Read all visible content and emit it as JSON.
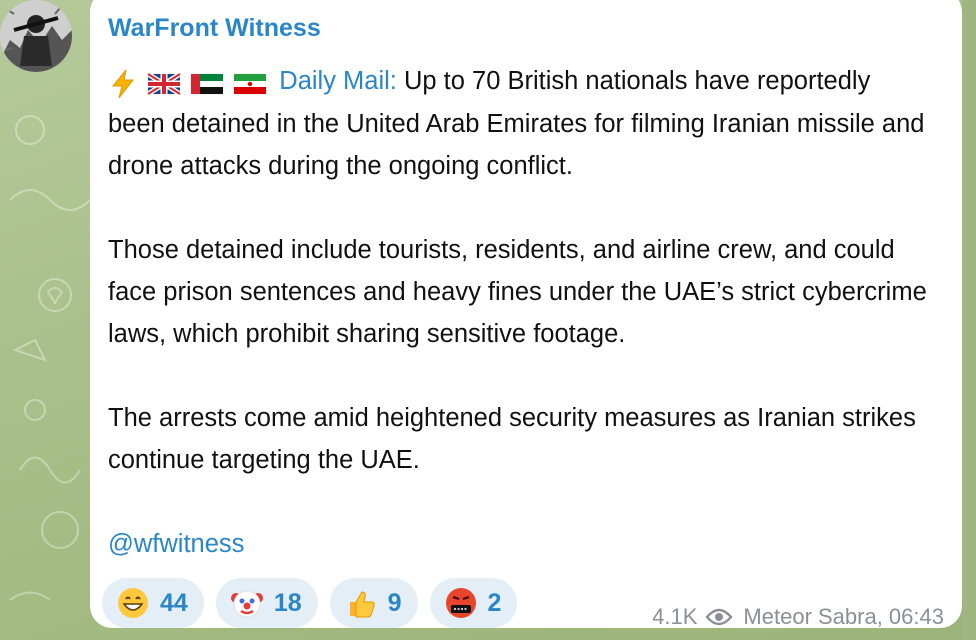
{
  "channel": {
    "name": "WarFront Witness"
  },
  "message": {
    "source_label": "Daily Mail:",
    "paragraphs": [
      "Up to 70 British nationals have reportedly been detained in the United Arab Emirates for filming Iranian missile and drone attacks during the ongoing conflict.",
      "Those detained include tourists, residents, and airline crew, and could face prison sentences and heavy fines under the UAE’s strict cybercrime laws, which prohibit sharing sensitive footage.",
      "The arrests come amid heightened security measures as Iranian strikes continue targeting the UAE."
    ],
    "lead_emojis": [
      "lightning-emoji",
      "uk-flag-emoji",
      "uae-flag-emoji",
      "iran-flag-emoji"
    ],
    "handle": "@wfwitness"
  },
  "reactions": [
    {
      "emoji": "grinning-face-emoji",
      "count": "44"
    },
    {
      "emoji": "clown-face-emoji",
      "count": "18"
    },
    {
      "emoji": "thumbs-up-emoji",
      "count": "9"
    },
    {
      "emoji": "cursing-face-emoji",
      "count": "2"
    }
  ],
  "meta": {
    "views": "4.1K",
    "author_time": "Meteor Sabra, 06:43"
  },
  "colors": {
    "accent": "#2b86c7",
    "reaction_bg": "#e4eef6",
    "meta_text": "#8a9096",
    "wallpaper": "#a9c08a"
  }
}
